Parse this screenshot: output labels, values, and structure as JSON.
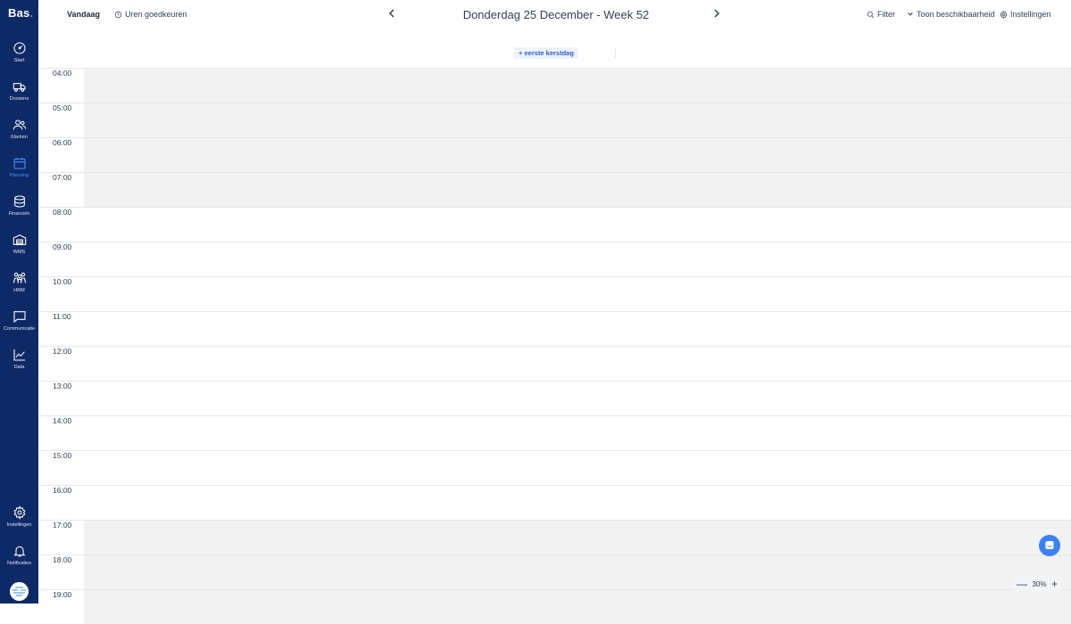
{
  "app": {
    "logo_text": "Bas"
  },
  "sidebar": {
    "items": [
      {
        "label": "Start",
        "icon": "gauge-icon"
      },
      {
        "label": "Dossiers",
        "icon": "truck-icon"
      },
      {
        "label": "Klanten",
        "icon": "users-icon"
      },
      {
        "label": "Planning",
        "icon": "calendar-icon",
        "active": true
      },
      {
        "label": "Financiën",
        "icon": "coins-icon"
      },
      {
        "label": "WMS",
        "icon": "warehouse-icon"
      },
      {
        "label": "HRM",
        "icon": "team-icon"
      },
      {
        "label": "Communicatie",
        "icon": "chat-icon"
      },
      {
        "label": "Data",
        "icon": "chart-icon"
      }
    ],
    "bottom_items": [
      {
        "label": "Instellingen",
        "icon": "gear-icon"
      },
      {
        "label": "Notificaties",
        "icon": "bell-icon"
      }
    ]
  },
  "topbar": {
    "today_label": "Vandaag",
    "approve_hours_label": "Uren goedkeuren",
    "date_title": "Donderdag 25 December - Week 52",
    "filter_label": "Filter",
    "availability_label": "Toon beschikbaarheid",
    "settings_label": "Instellingen"
  },
  "holiday": {
    "label": "eerste kerstdag"
  },
  "schedule": {
    "hours": [
      "04:00",
      "05:00",
      "06:00",
      "07:00",
      "08:00",
      "09:00",
      "10:00",
      "11:00",
      "12:00",
      "13:00",
      "14:00",
      "15:00",
      "16:00",
      "17:00",
      "18:00",
      "19:00"
    ],
    "working_start": "08:00",
    "working_end": "17:00"
  },
  "zoom": {
    "level": "30%"
  },
  "colors": {
    "sidebar_bg": "#0e2a66",
    "accent": "#3b82f6",
    "off_hours_bg": "#f2f2f2"
  }
}
